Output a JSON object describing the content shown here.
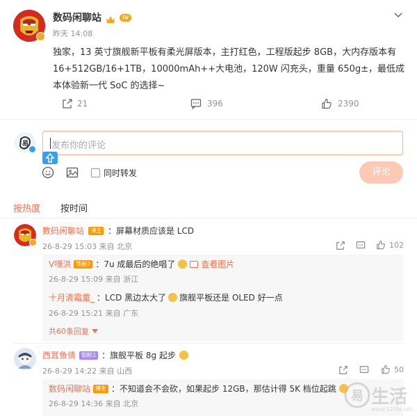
{
  "post": {
    "author": "数码闲聊站",
    "level_badge": "IV",
    "time": "昨天 14:08",
    "text": "独家，13 英寸旗舰新平板有柔光屏版本，主打红色，工程版起步 8GB，大内存版本有 16+512GB/16+1TB，10000mAh++大电池，120W 闪充头，重量 650g±，最低成本体验新一代 SoC 的选择~",
    "reposts": "21",
    "comments": "396",
    "likes": "2390"
  },
  "compose": {
    "placeholder": "发布你的评论",
    "also_repost": "同时转发",
    "submit": "评论"
  },
  "sort_tabs": [
    "按热度",
    "按时间"
  ],
  "comments": [
    {
      "author": "数码闲聊站",
      "badge": "博主",
      "text": "屏幕材质应该是 LCD",
      "meta": "26-8-29 15:03 来自 北京",
      "likes": "102",
      "replies": [
        {
          "author": "V嘿洪",
          "badge": "铁粉2",
          "text": "：7u 成最后的绝唱了",
          "link": "查看图片",
          "meta": "26-8-29 15:09 来自 浙江"
        },
        {
          "author": "十月清霜重_",
          "text": "：LCD 黑边太大了",
          "text2": "旗舰平板还是 OLED 好一点",
          "meta": "26-8-29 15:21 来自 广东"
        }
      ],
      "more_replies": "共60条回复"
    },
    {
      "author": "西耳鱼倩",
      "badge": "铂粉2",
      "text": "：旗舰平板 8g 起步",
      "meta": "26-8-29 14:22 来自 山西",
      "likes": "50",
      "replies": [
        {
          "author": "数码闲聊站",
          "badge": "博主",
          "text": "：不知道会不会砍，如果起步 12GB，那估计得 5K 档位起跳",
          "meta": "26-8-29 14:36 来自 北京"
        }
      ]
    }
  ],
  "watermark": {
    "brand": "生活",
    "url": "www.52life.net"
  },
  "colors": {
    "accent": "#eb7350",
    "submit_bg": "#fbc9b4",
    "input_border": "#f7b28f",
    "link": "#eb7350"
  }
}
